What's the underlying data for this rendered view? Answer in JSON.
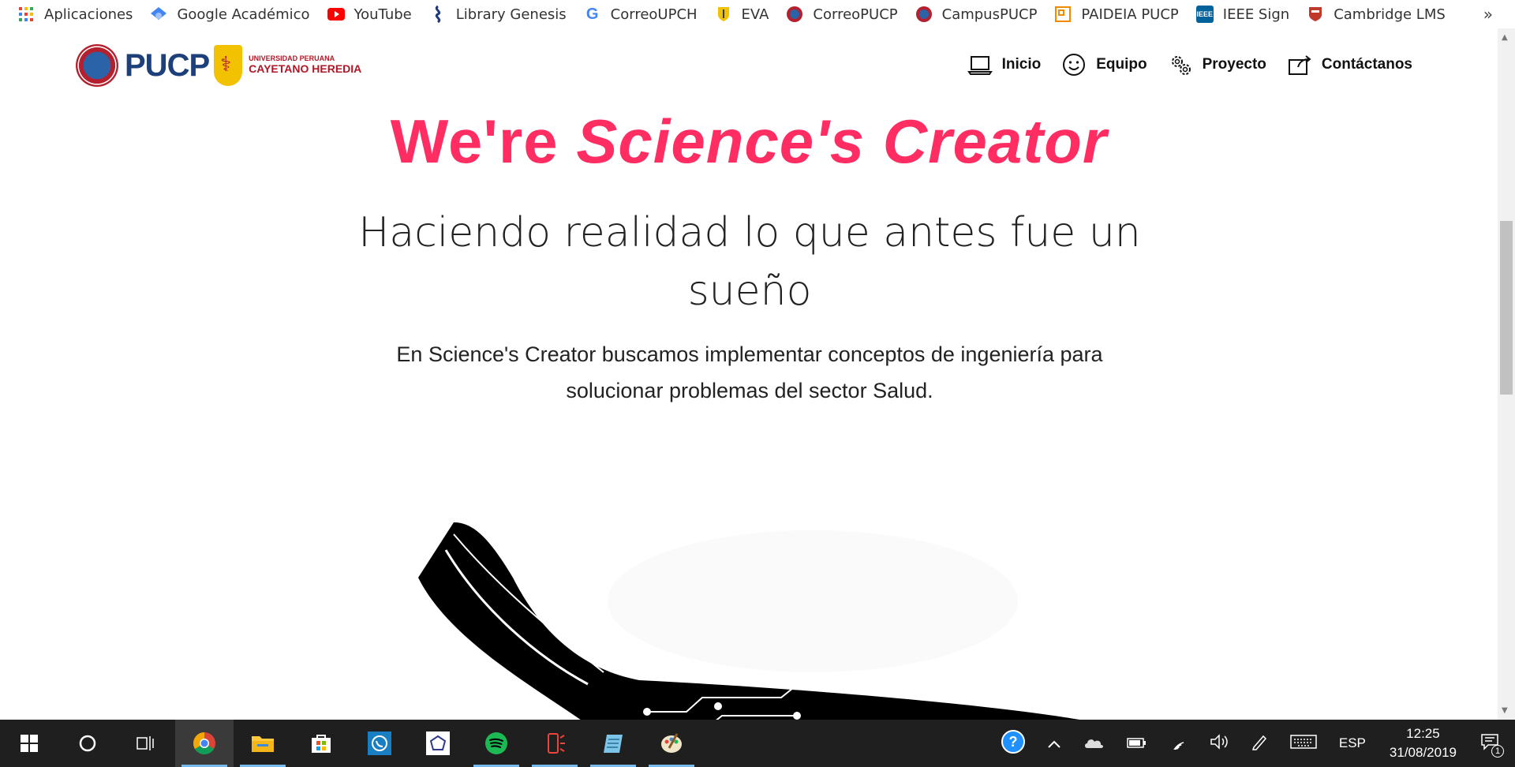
{
  "bookmarks": [
    {
      "label": "Aplicaciones",
      "icon": "apps-grid-icon"
    },
    {
      "label": "Google Académico",
      "icon": "google-scholar-icon"
    },
    {
      "label": "YouTube",
      "icon": "youtube-icon"
    },
    {
      "label": "Library Genesis",
      "icon": "library-genesis-icon"
    },
    {
      "label": "CorreoUPCH",
      "icon": "google-icon"
    },
    {
      "label": "EVA",
      "icon": "upch-shield-icon"
    },
    {
      "label": "CorreoPUCP",
      "icon": "pucp-seal-icon"
    },
    {
      "label": "CampusPUCP",
      "icon": "pucp-seal-icon"
    },
    {
      "label": "PAIDEIA PUCP",
      "icon": "paideia-icon"
    },
    {
      "label": "IEEE Sign",
      "icon": "ieee-icon"
    },
    {
      "label": "Cambridge LMS",
      "icon": "cambridge-icon"
    }
  ],
  "bookmarks_more": "»",
  "site": {
    "logo_pucp": "PUCP",
    "logo_upch_small": "UNIVERSIDAD PERUANA",
    "logo_upch_big": "CAYETANO HEREDIA",
    "nav": [
      {
        "label": "Inicio",
        "icon": "laptop-icon"
      },
      {
        "label": "Equipo",
        "icon": "smiley-icon"
      },
      {
        "label": "Proyecto",
        "icon": "gears-icon"
      },
      {
        "label": "Contáctanos",
        "icon": "share-icon"
      }
    ]
  },
  "hero": {
    "title_plain": "We're ",
    "title_italic": "Science's Creator",
    "subtitle": "Haciendo realidad lo que antes fue un sueño",
    "description": "En Science's Creator buscamos implementar conceptos de ingeniería para solucionar problemas del sector Salud."
  },
  "taskbar": {
    "apps": [
      "start-icon",
      "cortana-icon",
      "task-view-icon",
      "chrome-icon",
      "file-explorer-icon",
      "store-icon",
      "whatsapp-icon",
      "app-icon",
      "spotify-icon",
      "phone-app-icon",
      "notepad-icon",
      "paint-icon"
    ],
    "language": "ESP",
    "time": "12:25",
    "date": "31/08/2019",
    "notifications": "1"
  },
  "colors": {
    "accent": "#ff2d61",
    "taskbar": "#1f1f1f",
    "pucp_blue": "#1d3f7a",
    "upch_red": "#b01827"
  }
}
